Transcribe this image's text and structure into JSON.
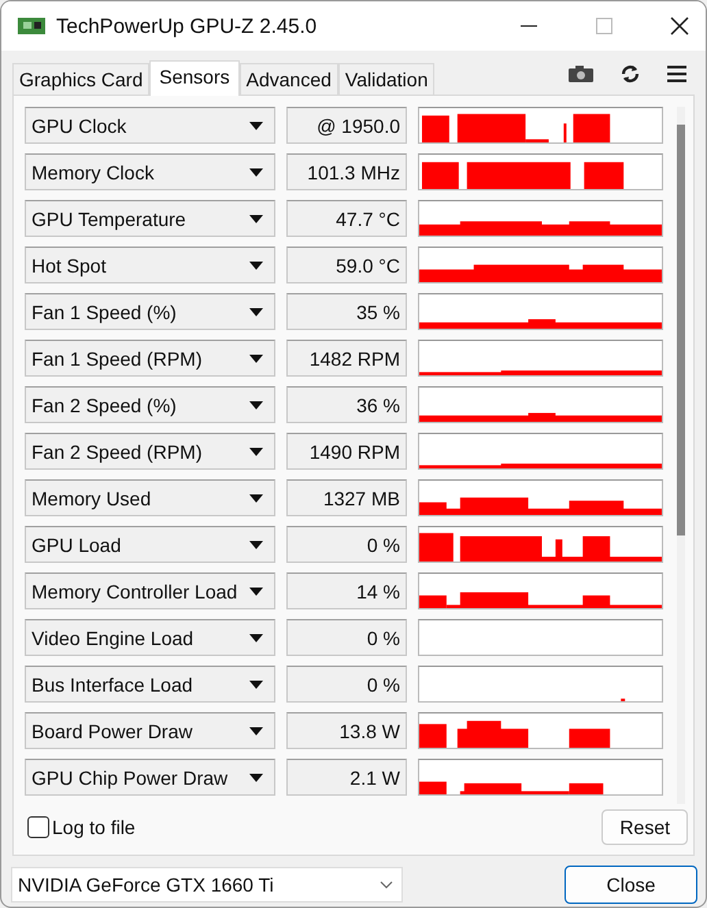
{
  "window": {
    "title": "TechPowerUp GPU-Z 2.45.0"
  },
  "tabs": [
    {
      "label": "Graphics Card",
      "selected": false
    },
    {
      "label": "Sensors",
      "selected": true
    },
    {
      "label": "Advanced",
      "selected": false
    },
    {
      "label": "Validation",
      "selected": false
    }
  ],
  "sensors": [
    {
      "name": "GPU Clock",
      "value": "@ 1950.0"
    },
    {
      "name": "Memory Clock",
      "value": "101.3 MHz"
    },
    {
      "name": "GPU Temperature",
      "value": "47.7 °C"
    },
    {
      "name": "Hot Spot",
      "value": "59.0 °C"
    },
    {
      "name": "Fan 1 Speed (%)",
      "value": "35 %"
    },
    {
      "name": "Fan 1 Speed (RPM)",
      "value": "1482 RPM"
    },
    {
      "name": "Fan 2 Speed (%)",
      "value": "36 %"
    },
    {
      "name": "Fan 2 Speed (RPM)",
      "value": "1490 RPM"
    },
    {
      "name": "Memory Used",
      "value": "1327 MB"
    },
    {
      "name": "GPU Load",
      "value": "0 %"
    },
    {
      "name": "Memory Controller Load",
      "value": "14 %"
    },
    {
      "name": "Video Engine Load",
      "value": "0 %"
    },
    {
      "name": "Bus Interface Load",
      "value": "0 %"
    },
    {
      "name": "Board Power Draw",
      "value": "13.8 W"
    },
    {
      "name": "GPU Chip Power Draw",
      "value": "2.1 W"
    }
  ],
  "log_to_file": {
    "label": "Log to file",
    "checked": false
  },
  "reset_button": "Reset",
  "device": {
    "value": "NVIDIA GeForce GTX 1660 Ti"
  },
  "close_button": "Close"
}
